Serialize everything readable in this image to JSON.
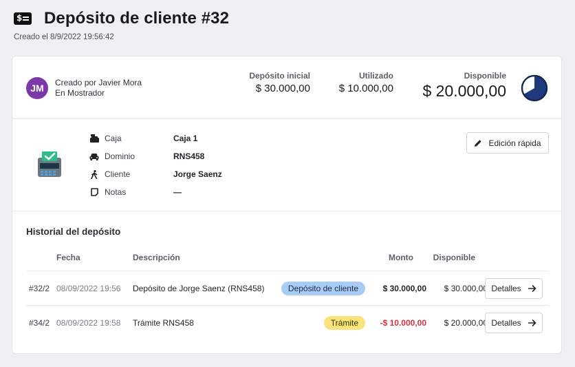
{
  "header": {
    "title": "Depósito de cliente #32",
    "subtitle": "Creado el 8/9/2022 19:56:42",
    "icon": "money-bill-icon"
  },
  "summary": {
    "avatar_initials": "JM",
    "avatar_color": "#7b3aa8",
    "created_by": "Creado por Javier Mora",
    "location": "En Mostrador",
    "initial_label": "Depósito inicial",
    "initial_value": "$ 30.000,00",
    "used_label": "Utilizado",
    "used_value": "$ 10.000,00",
    "available_label": "Disponible",
    "available_value": "$ 20.000,00",
    "available_fraction": 0.667,
    "pie_color": "#1e3a7a"
  },
  "details": {
    "rows": [
      {
        "icon": "cash-register-icon",
        "label": "Caja",
        "value": "Caja 1"
      },
      {
        "icon": "car-icon",
        "label": "Dominio",
        "value": "RNS458"
      },
      {
        "icon": "person-walking-icon",
        "label": "Cliente",
        "value": "Jorge Saenz"
      },
      {
        "icon": "note-icon",
        "label": "Notas",
        "value": "—"
      }
    ],
    "quick_edit_label": "Edición rápida"
  },
  "history": {
    "title": "Historial del depósito",
    "columns": {
      "fecha": "Fecha",
      "descripcion": "Descripción",
      "monto": "Monto",
      "disponible": "Disponible"
    },
    "rows": [
      {
        "id": "#32/2",
        "date": "08/09/2022 19:56",
        "description": "Depósito de Jorge Saenz (RNS458)",
        "badge": "Depósito de cliente",
        "badge_color": "#a8ccf3",
        "amount": "$ 30.000,00",
        "available": "$ 30.000,00",
        "button": "Detalles"
      },
      {
        "id": "#34/2",
        "date": "08/09/2022 19:58",
        "description": "Trámite RNS458",
        "badge": "Trámite",
        "badge_color": "#f9e37a",
        "amount": "-$ 10.000,00",
        "available": "$ 20.000,00",
        "button": "Detalles"
      }
    ]
  }
}
